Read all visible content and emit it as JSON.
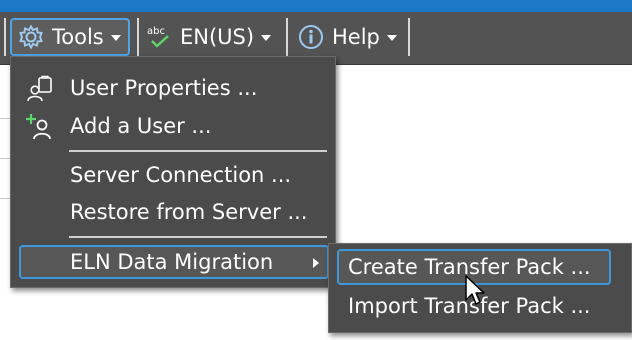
{
  "toolbar": {
    "tools_label": "Tools",
    "language_label": "EN(US)",
    "help_label": "Help",
    "icons": {
      "tools": "gear-icon",
      "language": "spellcheck-icon",
      "help": "info-icon"
    }
  },
  "tools_menu": {
    "items": [
      {
        "label": "User Properties ...",
        "icon": "user-properties-icon"
      },
      {
        "label": "Add a User ...",
        "icon": "add-user-icon"
      },
      {
        "label": "Server Connection ..."
      },
      {
        "label": "Restore from Server ..."
      },
      {
        "label": "ELN Data Migration",
        "has_submenu": true
      }
    ]
  },
  "migration_submenu": {
    "items": [
      {
        "label": "Create Transfer Pack ..."
      },
      {
        "label": "Import Transfer Pack ..."
      }
    ]
  },
  "colors": {
    "accent_border": "#4fa3e6",
    "menu_background": "#4b4b4b",
    "toolbar_background": "#535353",
    "top_strip": "#1e78c8"
  }
}
